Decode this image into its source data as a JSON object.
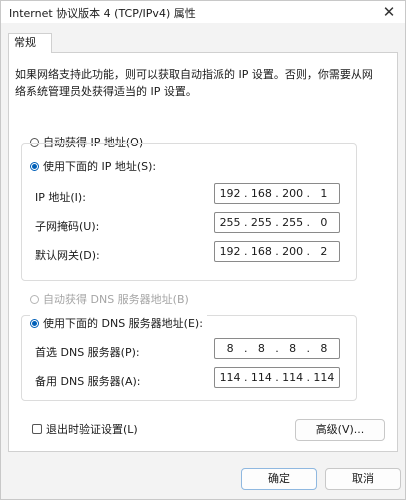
{
  "window": {
    "title": "Internet 协议版本 4 (TCP/IPv4) 属性",
    "close_symbol": "✕"
  },
  "tabs": [
    {
      "label": "常规",
      "selected": true
    }
  ],
  "description": {
    "line1": "如果网络支持此功能，则可以获取自动指派的 IP 设置。否则，你需要从网",
    "line2": "络系统管理员处获得适当的 IP 设置。"
  },
  "ip_section": {
    "auto_label": "自动获得 IP 地址(O)",
    "manual_label": "使用下面的 IP 地址(S):",
    "manual_selected": true,
    "ip_address": {
      "label": "IP 地址(I):",
      "octets": [
        "192",
        "168",
        "200",
        "1"
      ]
    },
    "subnet_mask": {
      "label": "子网掩码(U):",
      "octets": [
        "255",
        "255",
        "255",
        "0"
      ]
    },
    "gateway": {
      "label": "默认网关(D):",
      "octets": [
        "192",
        "168",
        "200",
        "2"
      ]
    }
  },
  "dns_section": {
    "auto_label": "自动获得 DNS 服务器地址(B)",
    "manual_label": "使用下面的 DNS 服务器地址(E):",
    "manual_selected": true,
    "preferred": {
      "label": "首选 DNS 服务器(P):",
      "octets": [
        "8",
        "8",
        "8",
        "8"
      ]
    },
    "alternate": {
      "label": "备用 DNS 服务器(A):",
      "octets": [
        "114",
        "114",
        "114",
        "114"
      ]
    }
  },
  "validate": {
    "label": "退出时验证设置(L)",
    "checked": false
  },
  "buttons": {
    "advanced": "高级(V)...",
    "ok": "确定",
    "cancel": "取消"
  }
}
